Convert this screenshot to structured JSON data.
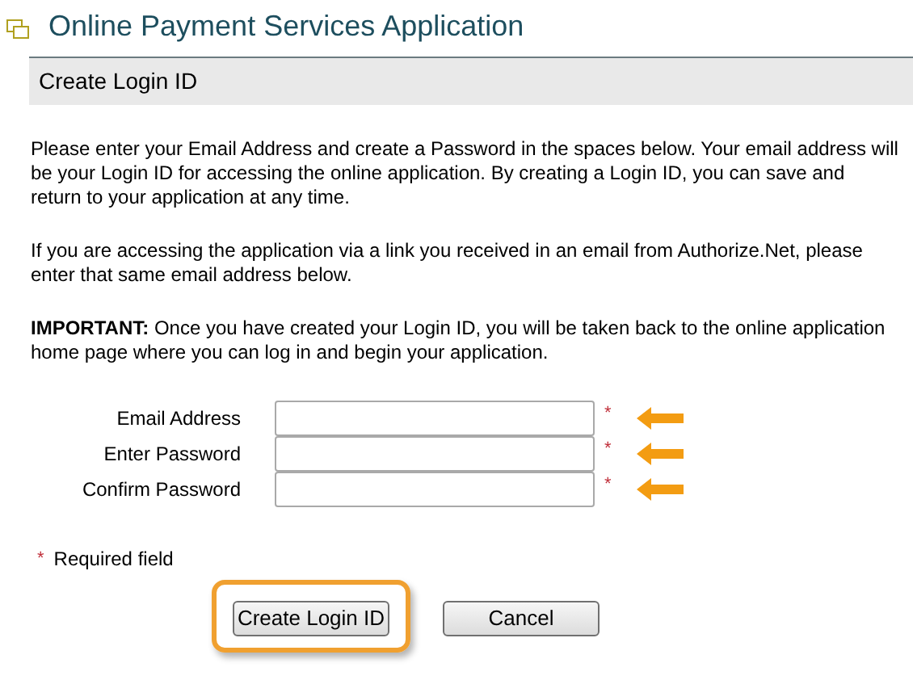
{
  "title": "Online Payment Services Application",
  "section": "Create Login ID",
  "paragraphs": [
    {
      "text": "Please enter your Email Address and create a Password in the spaces below. Your email address will be your Login ID for accessing the online application. By creating a Login ID, you can save and return to your application at any time."
    },
    {
      "text": "If you are accessing the application via a link you received in an email from Authorize.Net, please enter that same email address below."
    },
    {
      "text": "**IMPORTANT:** Once you have created your Login ID, you will be taken back to the online application home page where you can log in and begin your application."
    }
  ],
  "fields": [
    {
      "label": "Email Address",
      "mark": "*",
      "highlighted": true
    },
    {
      "label": "Enter Password",
      "mark": "*",
      "highlighted": true
    },
    {
      "label": "Confirm Password",
      "mark": "*",
      "highlighted": true
    }
  ],
  "required_note": {
    "mark": "*",
    "text": "Required field"
  },
  "buttons": [
    {
      "label": "Create Login ID",
      "highlighted": true
    },
    {
      "label": "Cancel",
      "highlighted": false
    }
  ]
}
